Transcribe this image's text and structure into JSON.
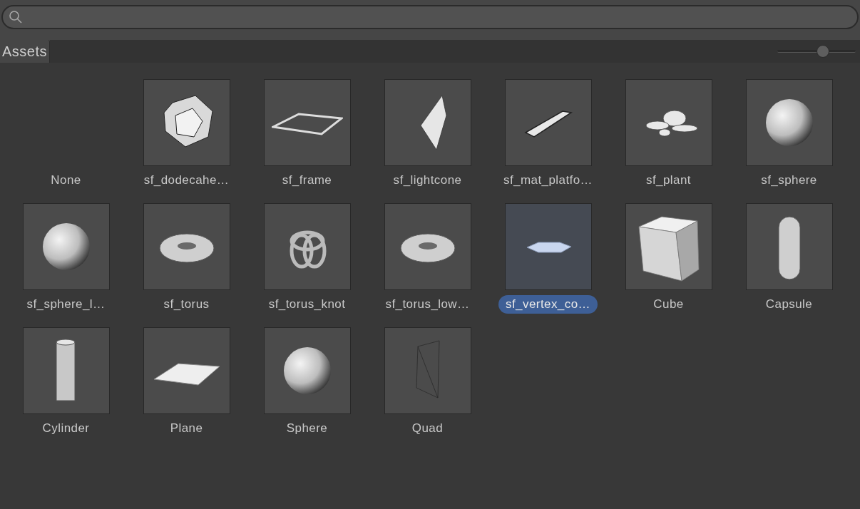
{
  "tabs": [
    {
      "label": "Assets",
      "selected": true
    }
  ],
  "zoom_slider": {
    "level": 0.58
  },
  "assets": [
    {
      "name": "None",
      "kind": "none",
      "selected": false
    },
    {
      "name": "sf_dodecahe…",
      "kind": "dodecahedron",
      "selected": false
    },
    {
      "name": "sf_frame",
      "kind": "frame",
      "selected": false
    },
    {
      "name": "sf_lightcone",
      "kind": "cone",
      "selected": false
    },
    {
      "name": "sf_mat_platfo…",
      "kind": "platform",
      "selected": false
    },
    {
      "name": "sf_plant",
      "kind": "plant",
      "selected": false
    },
    {
      "name": "sf_sphere",
      "kind": "sphere",
      "selected": false
    },
    {
      "name": "sf_sphere_l…",
      "kind": "sphere",
      "selected": false
    },
    {
      "name": "sf_torus",
      "kind": "torus",
      "selected": false
    },
    {
      "name": "sf_torus_knot",
      "kind": "knot",
      "selected": false
    },
    {
      "name": "sf_torus_low…",
      "kind": "torus",
      "selected": false
    },
    {
      "name": "sf_vertex_co…",
      "kind": "hexplate",
      "selected": true
    },
    {
      "name": "Cube",
      "kind": "cube",
      "selected": false
    },
    {
      "name": "Capsule",
      "kind": "capsule",
      "selected": false
    },
    {
      "name": "Cylinder",
      "kind": "cylinder",
      "selected": false
    },
    {
      "name": "Plane",
      "kind": "plane",
      "selected": false
    },
    {
      "name": "Sphere",
      "kind": "sphere",
      "selected": false
    },
    {
      "name": "Quad",
      "kind": "quad",
      "selected": false
    }
  ]
}
